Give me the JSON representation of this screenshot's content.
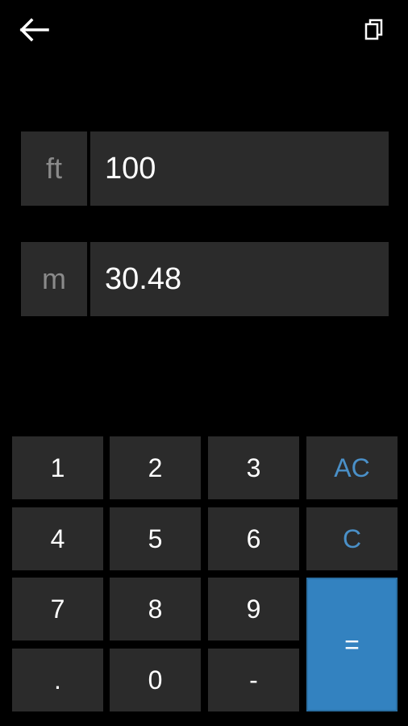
{
  "toolbar": {
    "back_icon": "arrow-left-icon",
    "copy_icon": "copy-icon"
  },
  "fields": [
    {
      "unit": "ft",
      "value": "100"
    },
    {
      "unit": "m",
      "value": "30.48"
    }
  ],
  "keypad": {
    "k1": "1",
    "k2": "2",
    "k3": "3",
    "ac": "AC",
    "k4": "4",
    "k5": "5",
    "k6": "6",
    "c": "C",
    "k7": "7",
    "k8": "8",
    "k9": "9",
    "equals": "=",
    "dot": ".",
    "k0": "0",
    "minus": "-"
  },
  "colors": {
    "background": "#000000",
    "key_bg": "#2b2b2b",
    "accent_text": "#4a90c8",
    "equals_bg": "#3382c0"
  }
}
